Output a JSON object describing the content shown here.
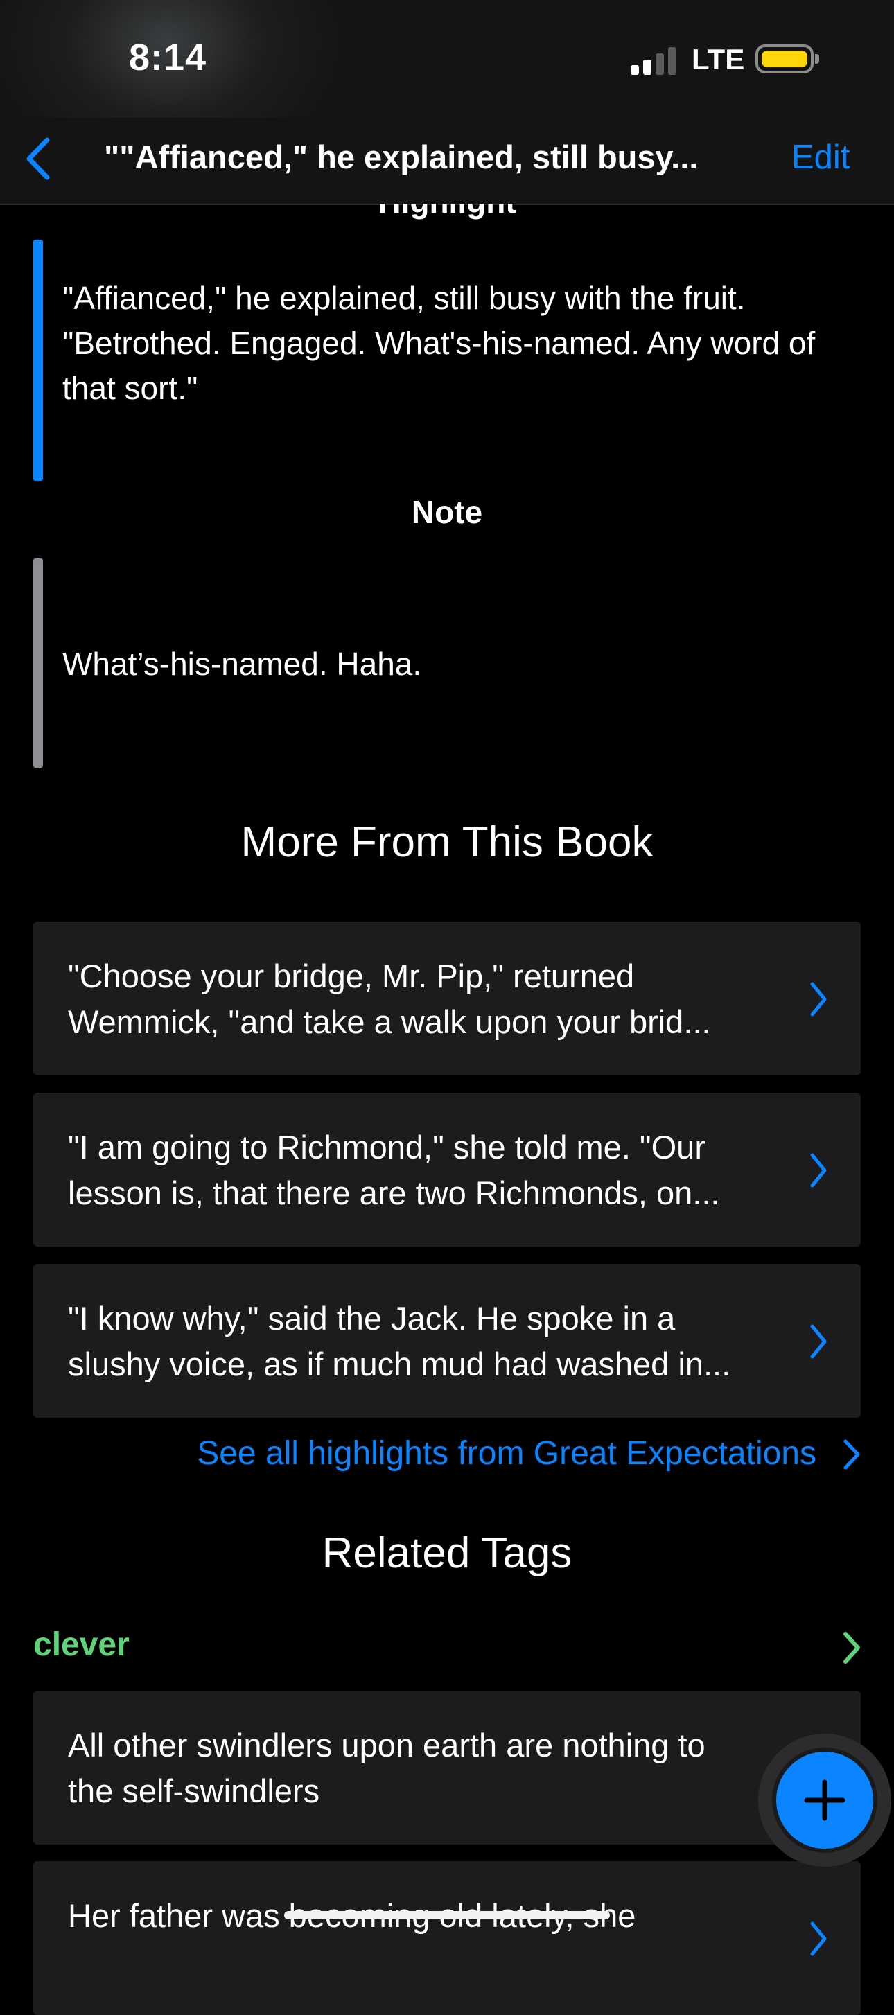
{
  "status_bar": {
    "time": "8:14",
    "network": "LTE",
    "battery_color": "#ffd60a"
  },
  "nav": {
    "title": "\"\"Affianced,\" he explained, still busy...",
    "edit_label": "Edit",
    "back_icon": "chevron-left-icon"
  },
  "highlight": {
    "heading": "Highlight",
    "text": "\"Affianced,\" he explained, still busy with the fruit. \"Betrothed. Engaged. What's-his-named. Any word of that sort.\""
  },
  "note": {
    "heading": "Note",
    "text": "What’s-his-named. Haha."
  },
  "more_from_book": {
    "title": "More From This Book",
    "items": [
      {
        "text": "\"Choose your bridge, Mr. Pip,\" returned\nWemmick, \"and take a walk upon your brid..."
      },
      {
        "text": "\"I am going to Richmond,\" she told me. \"Our\nlesson is, that there are two Richmonds, on..."
      },
      {
        "text": "\"I know why,\" said the Jack. He spoke in a\nslushy voice, as if much mud had washed in..."
      }
    ],
    "see_all": "See all highlights from Great Expectations"
  },
  "related_tags": {
    "title": "Related Tags",
    "tag": {
      "name": "clever",
      "color": "#5fd379"
    },
    "items": [
      {
        "text": "All other swindlers upon earth are nothing to\nthe self-swindlers"
      },
      {
        "text": "Her father was becoming old lately, she"
      }
    ]
  },
  "colors": {
    "accent": "#0a84ff",
    "card_bg": "#1c1c1e",
    "note_bar": "#8e8e93"
  }
}
